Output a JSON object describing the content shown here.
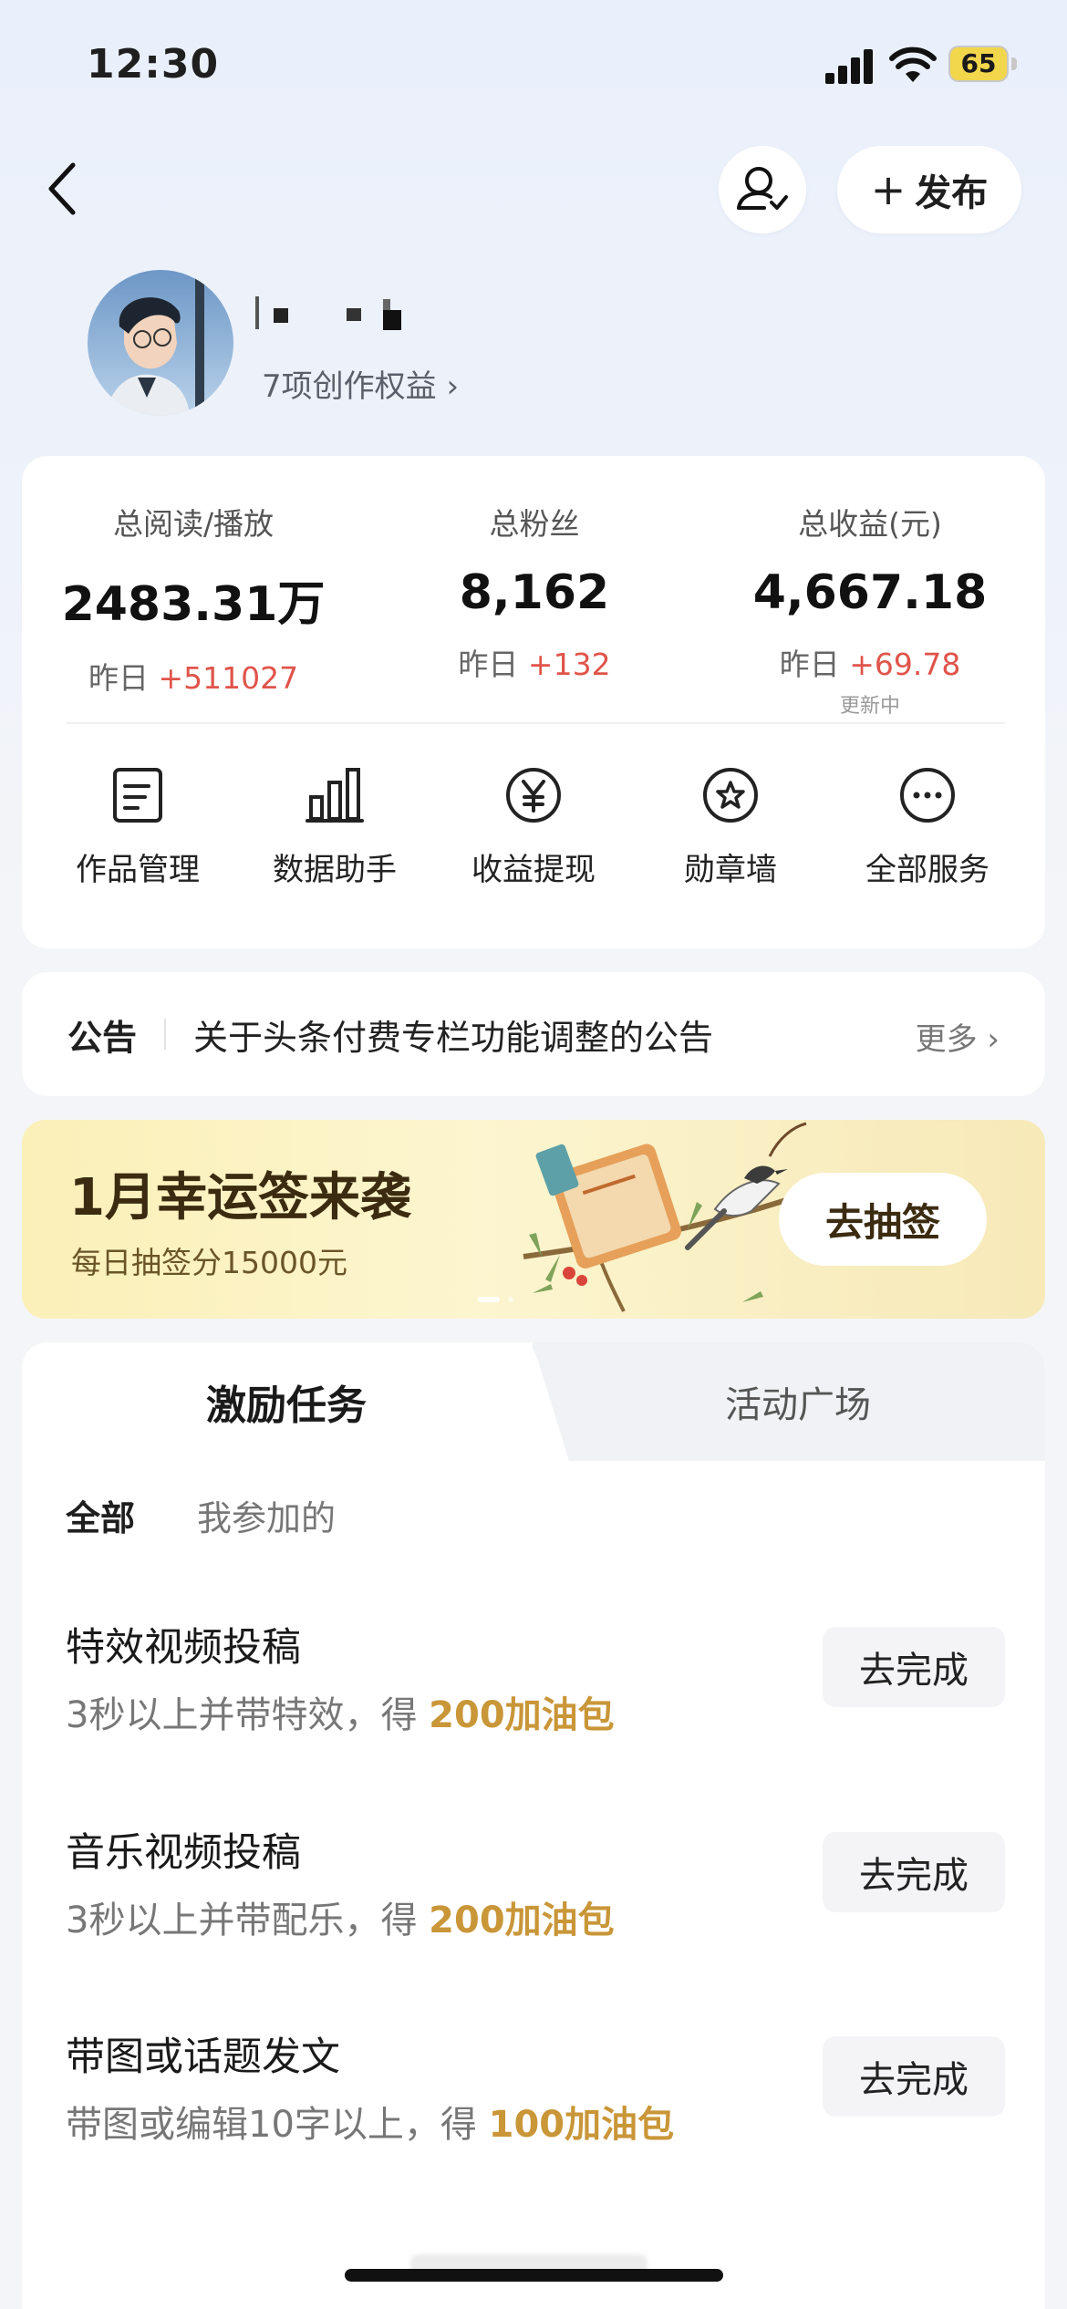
{
  "status_bar": {
    "time": "12:30",
    "battery": "65"
  },
  "header": {
    "publish_label": "发布"
  },
  "profile": {
    "rights": "7项创作权益 ›"
  },
  "stats": [
    {
      "label": "总阅读/播放",
      "value": "2483.31万",
      "delta_prefix": "昨日 ",
      "delta": "+511027",
      "note": ""
    },
    {
      "label": "总粉丝",
      "value": "8,162",
      "delta_prefix": "昨日 ",
      "delta": "+132",
      "note": ""
    },
    {
      "label": "总收益(元)",
      "value": "4,667.18",
      "delta_prefix": "昨日 ",
      "delta": "+69.78",
      "note": "更新中"
    }
  ],
  "services": [
    {
      "label": "作品管理",
      "icon": "document-icon"
    },
    {
      "label": "数据助手",
      "icon": "bar-chart-icon"
    },
    {
      "label": "收益提现",
      "icon": "yen-icon"
    },
    {
      "label": "勋章墙",
      "icon": "medal-icon"
    },
    {
      "label": "全部服务",
      "icon": "more-icon"
    }
  ],
  "notice": {
    "label": "公告",
    "text": "关于头条付费专栏功能调整的公告",
    "more": "更多 ›"
  },
  "banner": {
    "title": "1月幸运签来袭",
    "subtitle": "每日抽签分15000元",
    "button": "去抽签"
  },
  "tabs": {
    "active": "激励任务",
    "inactive": "活动广场"
  },
  "filters": {
    "all": "全部",
    "mine": "我参加的"
  },
  "tasks": [
    {
      "title": "特效视频投稿",
      "desc": "3秒以上并带特效，得 ",
      "reward": "200加油包",
      "button": "去完成"
    },
    {
      "title": "音乐视频投稿",
      "desc": "3秒以上并带配乐，得 ",
      "reward": "200加油包",
      "button": "去完成"
    },
    {
      "title": "带图或话题发文",
      "desc": "带图或编辑10字以上，得 ",
      "reward": "100加油包",
      "button": "去完成"
    }
  ],
  "colors": {
    "accent_red": "#e0544a",
    "reward_gold": "#c99638",
    "battery_yellow": "#f2d64b"
  }
}
